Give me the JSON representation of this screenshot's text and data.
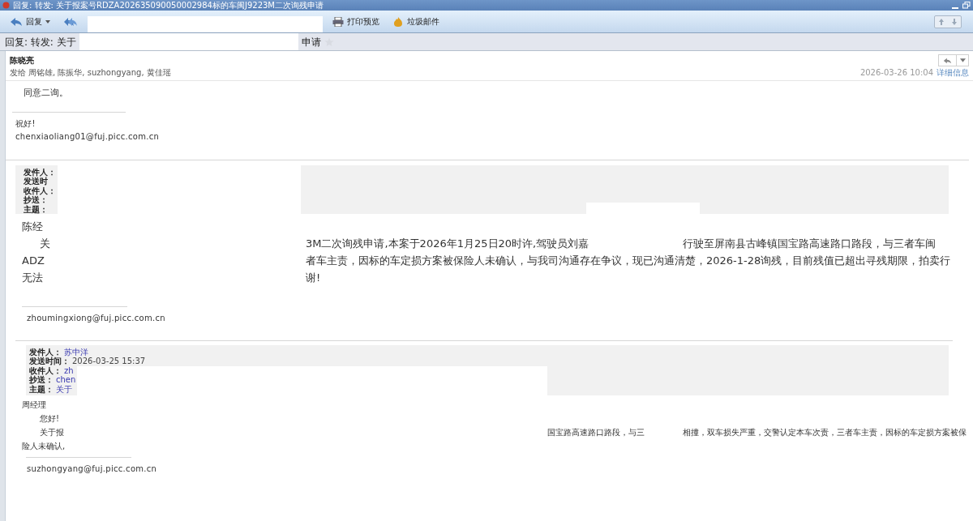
{
  "window": {
    "title": "回复: 转发: 关于报案号RDZA202635090050002984标的车闽J9223M二次询残申请"
  },
  "toolbar": {
    "buttons": [
      {
        "kind": "reply",
        "label": "回复"
      },
      {
        "kind": "forward"
      },
      {
        "kind": "print",
        "label": "打印预览"
      },
      {
        "kind": "spam",
        "label": "垃圾邮件"
      }
    ]
  },
  "subject": {
    "start": "回复: 转发: 关于",
    "end": "申请",
    "starred": false
  },
  "message": {
    "sender": "陈晓亮",
    "recipients_label": "发给",
    "recipients": "周铭雄, 陈振华, suzhongyang, 黄佳瑶",
    "date": "2026-03-26 10:04",
    "details_link": "详细信息"
  },
  "body": {
    "reply_text": "同意二询。",
    "signature": [
      "祝好!",
      "chenxiaoliang01@fuj.picc.com.cn"
    ]
  },
  "quotes": [
    {
      "kind": "large",
      "header_fields": [
        {
          "label": "发件人："
        },
        {
          "label": "发送时"
        },
        {
          "label": "收件人："
        },
        {
          "label": "抄送："
        },
        {
          "label": "主题："
        }
      ],
      "lines": [
        {
          "left": "陈经",
          "indent": false
        },
        {
          "left": "关",
          "indent": true,
          "middle": "3M二次询残申请,本案于2026年1月25日20时许,驾驶员刘嘉",
          "right": "行驶至屏南县古峰镇国宝路高速路口路段，与三者车闽"
        },
        {
          "left": "ADZ",
          "indent": false,
          "middle": "者车主责，因标的车定损方案被保险人未确认，与我司沟通存在争议，现已沟通清楚，2026-1-28询残，目前残值已超出寻残期限，拍卖行"
        },
        {
          "left": "无法",
          "indent": false,
          "middle": "谢!"
        }
      ],
      "signature": "zhoumingxiong@fuj.picc.com.cn"
    },
    {
      "kind": "small",
      "header_fields": [
        {
          "label": "发件人：",
          "value": "苏中洋"
        },
        {
          "label": "发送时间：",
          "value": "2026-03-25 15:37"
        },
        {
          "label": "收件人：",
          "value": "zh"
        },
        {
          "label": "抄送：",
          "value": "chen"
        },
        {
          "label": "主题：",
          "value": "关于"
        }
      ],
      "lines": [
        {
          "left": "周经理",
          "indent": false
        },
        {
          "left": "您好!",
          "indent": true
        },
        {
          "left": "关于报",
          "indent": true,
          "middle": "国宝路高速路口路段，与三",
          "right": "相撞，双车损失严重，交警认定本车次责，三者车主责，因标的车定损方案被保"
        },
        {
          "left": "险人未确认,",
          "indent": false
        }
      ],
      "signature": "suzhongyang@fuj.picc.com.cn"
    }
  ]
}
